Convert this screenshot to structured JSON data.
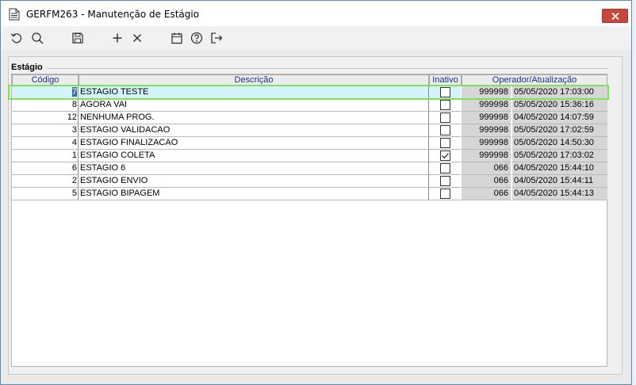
{
  "window": {
    "title": "GERFM263 - Manutenção de Estágio"
  },
  "toolbar": {
    "icons": [
      "refresh-icon",
      "search-icon",
      "save-icon",
      "add-icon",
      "delete-icon",
      "calendar-icon",
      "help-icon",
      "exit-icon"
    ]
  },
  "group": {
    "label": "Estágio"
  },
  "columns": {
    "codigo": "Código",
    "descricao": "Descrição",
    "inativo": "Inativo",
    "operador": "Operador/Atualização"
  },
  "rows": [
    {
      "codigo": "7",
      "descricao": "ESTAGIO TESTE",
      "inativo": false,
      "operador": "999998",
      "data": "05/05/2020 17:03:00",
      "selected": true
    },
    {
      "codigo": "8",
      "descricao": "AGORA VAI",
      "inativo": false,
      "operador": "999998",
      "data": "05/05/2020 15:36:16"
    },
    {
      "codigo": "12",
      "descricao": "NENHUMA PROG.",
      "inativo": false,
      "operador": "999998",
      "data": "04/05/2020 14:07:59"
    },
    {
      "codigo": "3",
      "descricao": "ESTAGIO VALIDACAO",
      "inativo": false,
      "operador": "999998",
      "data": "05/05/2020 17:02:59"
    },
    {
      "codigo": "4",
      "descricao": "ESTAGIO FINALIZACAO",
      "inativo": false,
      "operador": "999998",
      "data": "05/05/2020 14:50:30"
    },
    {
      "codigo": "1",
      "descricao": "ESTAGIO COLETA",
      "inativo": true,
      "operador": "999998",
      "data": "05/05/2020 17:03:02"
    },
    {
      "codigo": "6",
      "descricao": "ESTAGIO 6",
      "inativo": false,
      "operador": "066",
      "data": "04/05/2020 15:44:10"
    },
    {
      "codigo": "2",
      "descricao": "ESTAGIO ENVIO",
      "inativo": false,
      "operador": "066",
      "data": "04/05/2020 15:44:11"
    },
    {
      "codigo": "5",
      "descricao": "ESTAGIO BIPAGEM",
      "inativo": false,
      "operador": "066",
      "data": "04/05/2020 15:44:13"
    }
  ],
  "colors": {
    "selection": "#d4f3fb",
    "selection_outline": "#7fe05a",
    "header_text": "#1a2e8c",
    "close_button": "#c7473c"
  }
}
